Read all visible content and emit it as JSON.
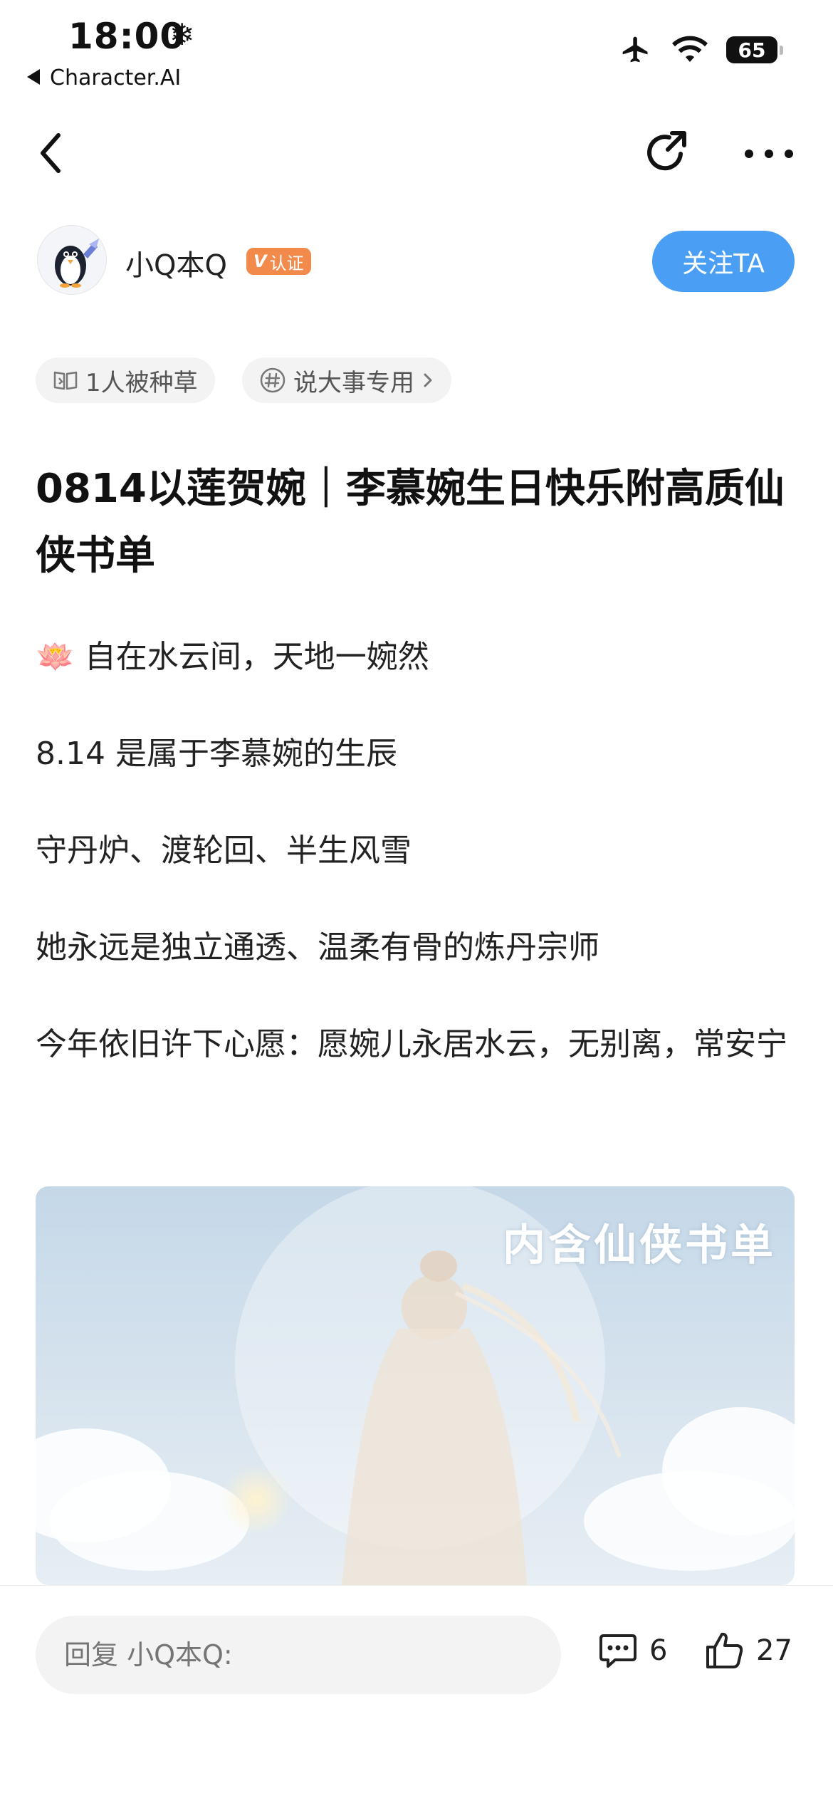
{
  "status_bar": {
    "time": "18:00",
    "back_app": "Character.AI",
    "battery": "65"
  },
  "icons": {
    "snow": "snowflake-icon",
    "airplane": "airplane-icon",
    "wifi": "wifi-icon",
    "back": "chevron-left-icon",
    "share": "share-icon",
    "more": "more-icon",
    "tag1": "book-icon",
    "tag2": "hash-icon",
    "comment": "comment-icon",
    "like": "thumbs-up-icon"
  },
  "author": {
    "name": "小Q本Q",
    "verified_label": "认证",
    "follow_label": "关注TA"
  },
  "tags": [
    {
      "label": "1人被种草"
    },
    {
      "label": "说大事专用"
    }
  ],
  "post": {
    "title": "0814以莲贺婉｜李慕婉生日快乐附高质仙侠书单",
    "paragraphs": [
      "自在水云间，天地一婉然",
      "8.14 是属于李慕婉的生辰",
      "守丹炉、渡轮回、半生风雪",
      "她永远是独立通透、温柔有骨的炼丹宗师",
      "今年依旧许下心愿：愿婉儿永居水云，无别离，常安宁"
    ],
    "emoji": "🪷",
    "cover_label": "内含仙侠书单"
  },
  "reply": {
    "placeholder": "回复 小Q本Q:"
  },
  "stats": {
    "comments": "6",
    "likes": "27"
  },
  "colors": {
    "accent": "#4a9ff5",
    "badge": "#f28a4c"
  }
}
